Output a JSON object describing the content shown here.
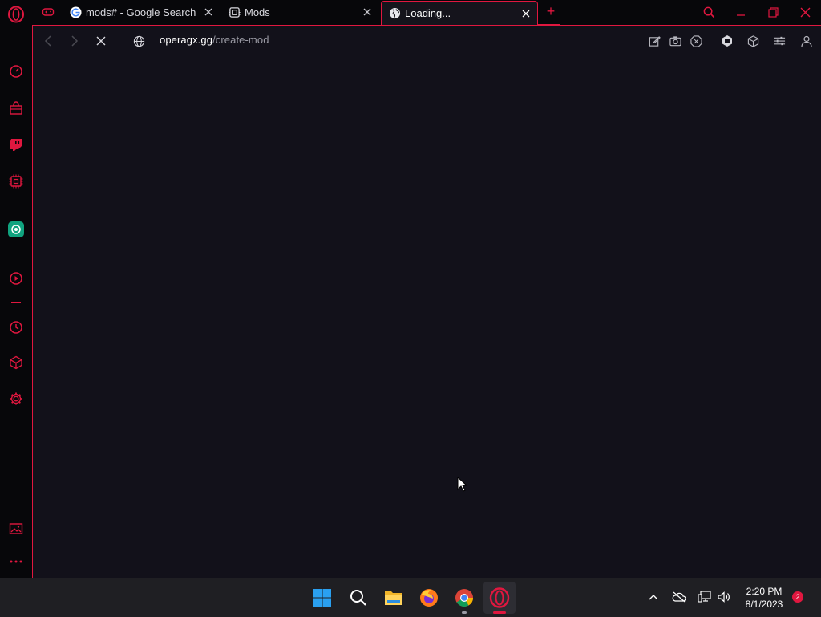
{
  "colors": {
    "accent": "#e0173f",
    "content_bg": "#12111a",
    "chrome_bg": "#07070a",
    "taskbar_bg": "#1f1f23"
  },
  "tabs": [
    {
      "label": "",
      "icon": "gamepad-icon",
      "active": false
    },
    {
      "label": "mods# - Google Search",
      "icon": "google-icon",
      "active": false
    },
    {
      "label": "Mods",
      "icon": "mods-icon",
      "active": false
    },
    {
      "label": "Loading...",
      "icon": "globe-icon",
      "active": true
    }
  ],
  "new_tab_symbol": "+",
  "address_bar": {
    "domain": "operagx.gg",
    "path": "/create-mod"
  },
  "sidebar": {
    "items": [
      "speed-dial-icon",
      "shopping-bag-icon",
      "twitch-icon",
      "cpu-icon",
      "chatgpt-icon",
      "player-icon",
      "history-icon",
      "cube-icon",
      "settings-icon",
      "gallery-icon",
      "more-icon"
    ]
  },
  "toolbar_icons": [
    "edit-icon",
    "camera-icon",
    "adblock-icon",
    "vpn-icon",
    "cube-icon",
    "easy-setup-icon",
    "profile-icon"
  ],
  "taskbar": {
    "apps": [
      "windows-start-icon",
      "search-icon",
      "file-explorer-icon",
      "firefox-icon",
      "chrome-icon",
      "opera-gx-icon"
    ],
    "time": "2:20 PM",
    "date": "8/1/2023",
    "notification_count": "2"
  }
}
